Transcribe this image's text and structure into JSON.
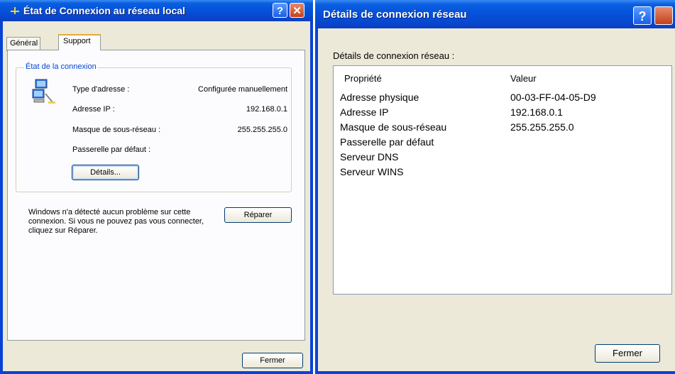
{
  "left_window": {
    "title": "État de Connexion au réseau local",
    "help_glyph": "?",
    "close_glyph": "✕",
    "tabs": [
      "Général",
      "Support"
    ],
    "group_title": "État de la connexion",
    "rows": [
      {
        "label": "Type d'adresse :",
        "value": "Configurée manuellement"
      },
      {
        "label": "Adresse IP :",
        "value": "192.168.0.1"
      },
      {
        "label": "Masque de sous-réseau :",
        "value": "255.255.255.0"
      },
      {
        "label": "Passerelle par défaut :",
        "value": ""
      }
    ],
    "details_button": "Détails...",
    "repair_text": "Windows n'a détecté aucun problème sur cette connexion. Si vous ne pouvez pas vous connecter, cliquez sur Réparer.",
    "repair_button": "Réparer",
    "close_button": "Fermer"
  },
  "right_window": {
    "title": "Détails de connexion réseau",
    "help_glyph": "?",
    "heading": "Détails de connexion réseau :",
    "columns": [
      "Propriété",
      "Valeur"
    ],
    "rows": [
      {
        "property": "Adresse physique",
        "value": "00-03-FF-04-05-D9"
      },
      {
        "property": "Adresse IP",
        "value": "192.168.0.1"
      },
      {
        "property": "Masque de sous-réseau",
        "value": "255.255.255.0"
      },
      {
        "property": "Passerelle par défaut",
        "value": ""
      },
      {
        "property": "Serveur DNS",
        "value": ""
      },
      {
        "property": "Serveur WINS",
        "value": ""
      }
    ],
    "close_button": "Fermer"
  },
  "icons": {
    "title_icon": "network-connection-icon",
    "connection_icon": "network-computers-icon"
  },
  "colors": {
    "titlebar_blue": "#0553da",
    "window_border": "#0842d6",
    "face": "#ece9d8",
    "group_title": "#0046d5"
  }
}
